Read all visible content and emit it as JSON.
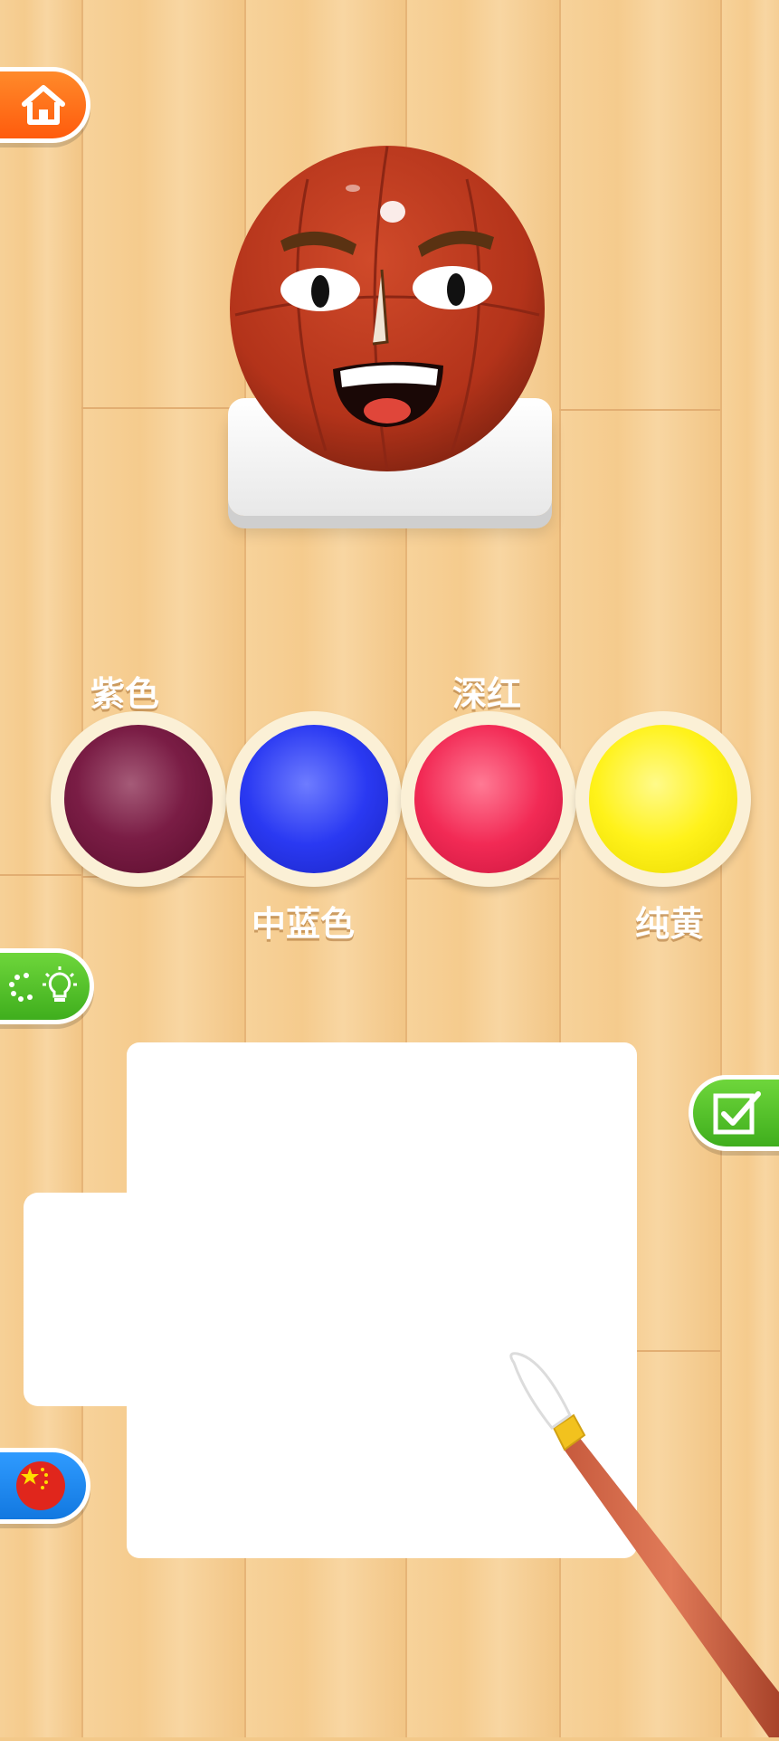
{
  "colors": {
    "accent_home": "#ff6a1a",
    "accent_hint": "#4dbd27",
    "accent_lang": "#1e88f0",
    "ball": "#b8351d"
  },
  "buttons": {
    "home_icon": "home-icon",
    "hint_icons": [
      "loading-ring-icon",
      "lightbulb-icon"
    ],
    "done_icon": "checkbox-check-icon",
    "language_icon": "china-flag-icon"
  },
  "palette": [
    {
      "label": "紫色",
      "color": "#6a1236"
    },
    {
      "label": "中蓝色",
      "color": "#2a39f2"
    },
    {
      "label": "深红",
      "color": "#f22a55"
    },
    {
      "label": "纯黄",
      "color": "#fff21a"
    }
  ]
}
